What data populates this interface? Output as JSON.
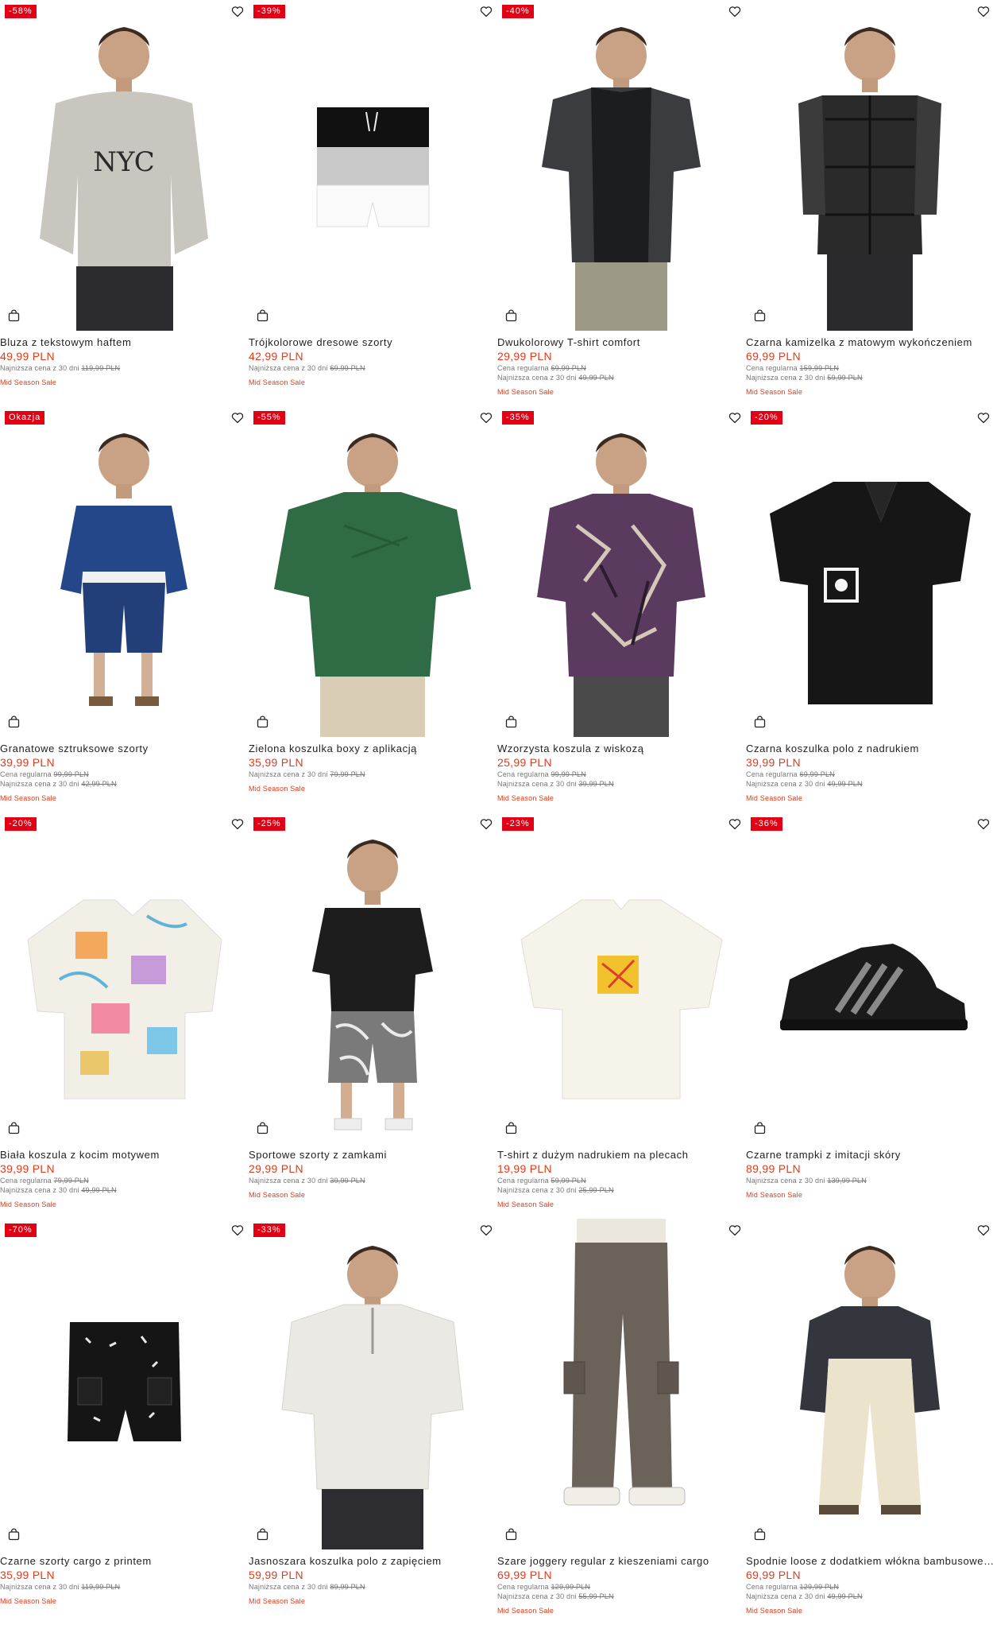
{
  "products": [
    {
      "name": "Bluza z tekstowym haftem",
      "price": "49,99 PLN",
      "badge": "-58%",
      "regular_label": "",
      "regular_price": "",
      "lowest_label": "Najniższa cena z 30 dni",
      "lowest_price": "119,99 PLN",
      "tag": "Mid Season Sale",
      "image": "grey-nyc-hoodie",
      "color": "#c9c6c0"
    },
    {
      "name": "Trójkolorowe dresowe szorty",
      "price": "42,99 PLN",
      "badge": "-39%",
      "regular_label": "",
      "regular_price": "",
      "lowest_label": "Najniższa cena z 30 dni",
      "lowest_price": "69,99 PLN",
      "tag": "Mid Season Sale",
      "image": "tricolor-shorts",
      "color": "#9a9a9a"
    },
    {
      "name": "Dwukolorowy T-shirt comfort",
      "price": "29,99 PLN",
      "badge": "-40%",
      "regular_label": "Cena regularna",
      "regular_price": "69,99 PLN",
      "lowest_label": "Najniższa cena z 30 dni",
      "lowest_price": "49,99 PLN",
      "tag": "Mid Season Sale",
      "image": "two-tone-tshirt",
      "color": "#3a3c40"
    },
    {
      "name": "Czarna kamizelka z matowym wykończeniem",
      "price": "69,99 PLN",
      "badge": "",
      "regular_label": "Cena regularna",
      "regular_price": "159,99 PLN",
      "lowest_label": "Najniższa cena z 30 dni",
      "lowest_price": "59,99 PLN",
      "tag": "Mid Season Sale",
      "image": "black-vest",
      "color": "#1e1e1e"
    },
    {
      "name": "Granatowe sztruksowe szorty",
      "price": "39,99 PLN",
      "badge": "Okazja",
      "regular_label": "Cena regularna",
      "regular_price": "99,99 PLN",
      "lowest_label": "Najniższa cena z 30 dni",
      "lowest_price": "42,99 PLN",
      "tag": "Mid Season Sale",
      "image": "navy-corduroy-shorts",
      "color": "#24478a"
    },
    {
      "name": "Zielona koszulka boxy z aplikacją",
      "price": "35,99 PLN",
      "badge": "-55%",
      "regular_label": "",
      "regular_price": "",
      "lowest_label": "Najniższa cena z 30 dni",
      "lowest_price": "79,99 PLN",
      "tag": "Mid Season Sale",
      "image": "green-boxy-tshirt",
      "color": "#2f6b45"
    },
    {
      "name": "Wzorzysta koszula z wiskozą",
      "price": "25,99 PLN",
      "badge": "-35%",
      "regular_label": "Cena regularna",
      "regular_price": "99,99 PLN",
      "lowest_label": "Najniższa cena z 30 dni",
      "lowest_price": "39,99 PLN",
      "tag": "Mid Season Sale",
      "image": "patterned-shirt",
      "color": "#5a3a5e"
    },
    {
      "name": "Czarna koszulka polo z nadrukiem",
      "price": "39,99 PLN",
      "badge": "-20%",
      "regular_label": "Cena regularna",
      "regular_price": "69,99 PLN",
      "lowest_label": "Najniższa cena z 30 dni",
      "lowest_price": "49,99 PLN",
      "tag": "Mid Season Sale",
      "image": "black-polo",
      "color": "#161616"
    },
    {
      "name": "Biała koszula z kocim motywem",
      "price": "39,99 PLN",
      "badge": "-20%",
      "regular_label": "Cena regularna",
      "regular_price": "79,99 PLN",
      "lowest_label": "Najniższa cena z 30 dni",
      "lowest_price": "49,99 PLN",
      "tag": "Mid Season Sale",
      "image": "cat-print-shirt",
      "color": "#f2efe6"
    },
    {
      "name": "Sportowe szorty z zamkami",
      "price": "29,99 PLN",
      "badge": "-25%",
      "regular_label": "",
      "regular_price": "",
      "lowest_label": "Najniższa cena z 30 dni",
      "lowest_price": "39,99 PLN",
      "tag": "Mid Season Sale",
      "image": "sport-shorts",
      "color": "#7a7a7a"
    },
    {
      "name": "T-shirt z dużym nadrukiem na plecach",
      "price": "19,99 PLN",
      "badge": "-23%",
      "regular_label": "Cena regularna",
      "regular_price": "59,99 PLN",
      "lowest_label": "Najniższa cena z 30 dni",
      "lowest_price": "25,99 PLN",
      "tag": "Mid Season Sale",
      "image": "white-tshirt",
      "color": "#f6f3ea"
    },
    {
      "name": "Czarne trampki z imitacji skóry",
      "price": "89,99 PLN",
      "badge": "-36%",
      "regular_label": "",
      "regular_price": "",
      "lowest_label": "Najniższa cena z 30 dni",
      "lowest_price": "139,99 PLN",
      "tag": "Mid Season Sale",
      "image": "black-sneakers",
      "color": "#1a1a1a"
    },
    {
      "name": "Czarne szorty cargo z printem",
      "price": "35,99 PLN",
      "badge": "-70%",
      "regular_label": "",
      "regular_price": "",
      "lowest_label": "Najniższa cena z 30 dni",
      "lowest_price": "119,99 PLN",
      "tag": "Mid Season Sale",
      "image": "black-cargo-shorts",
      "color": "#151515"
    },
    {
      "name": "Jasnoszara koszulka polo z zapięciem",
      "price": "59,99 PLN",
      "badge": "-33%",
      "regular_label": "",
      "regular_price": "",
      "lowest_label": "Najniższa cena z 30 dni",
      "lowest_price": "89,99 PLN",
      "tag": "Mid Season Sale",
      "image": "light-grey-polo",
      "color": "#ebe9e4"
    },
    {
      "name": "Szare joggery regular z kieszeniami cargo",
      "price": "69,99 PLN",
      "badge": "",
      "regular_label": "Cena regularna",
      "regular_price": "129,99 PLN",
      "lowest_label": "Najniższa cena z 30 dni",
      "lowest_price": "55,99 PLN",
      "tag": "Mid Season Sale",
      "image": "grey-cargo-joggers",
      "color": "#6b625a"
    },
    {
      "name": "Spodnie loose z dodatkiem włókna bambusowego",
      "price": "69,99 PLN",
      "badge": "",
      "regular_label": "Cena regularna",
      "regular_price": "129,99 PLN",
      "lowest_label": "Najniższa cena z 30 dni",
      "lowest_price": "49,99 PLN",
      "tag": "Mid Season Sale",
      "image": "loose-trousers",
      "color": "#ece3cc"
    }
  ],
  "icons": {
    "favorite": "heart-icon",
    "cart": "shopping-bag-icon"
  },
  "colors": {
    "accent": "#e23a1a",
    "badge": "#e10014"
  }
}
